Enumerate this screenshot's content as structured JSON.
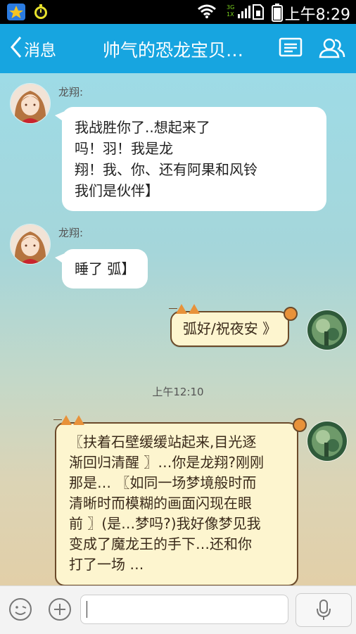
{
  "status_bar": {
    "network": "3G 1X",
    "time": "上午8:29"
  },
  "header": {
    "back_label": "消息",
    "title": "帅气的恐龙宝贝…"
  },
  "messages": [
    {
      "side": "left",
      "sender": "龙翔:",
      "lines": [
        "我战胜你了..想起来了",
        "吗！羽！我是龙",
        "翔！我、你、还有阿果和风铃",
        "我们是伙伴】"
      ]
    },
    {
      "side": "left",
      "sender": "龙翔:",
      "lines": [
        "睡了 弧】"
      ]
    },
    {
      "side": "right",
      "lines": [
        "弧好/祝夜安 》"
      ]
    },
    {
      "side": "right",
      "lines": [
        "〖扶着石壁缓缓站起来,目光逐",
        "渐回归清醒 〗…你是龙翔?刚刚",
        "那是… 〖如同一场梦境般时而",
        "清晰时而模糊的画面闪现在眼",
        "前 〗(是…梦吗?)我好像梦见我",
        "变成了魔龙王的手下…还和你",
        "打了一场 …"
      ]
    }
  ],
  "timestamp": "上午12:10",
  "input": {
    "placeholder": ""
  },
  "colors": {
    "titlebar": "#17a5e0",
    "cat_bubble_fill": "#fdf5cf",
    "cat_bubble_border": "#6b4a2a",
    "cat_ear": "#e8923a"
  },
  "icons": [
    "app-star-icon",
    "stopwatch-icon",
    "wifi-icon",
    "signal-icon",
    "sim-icon",
    "battery-icon",
    "back-chevron-icon",
    "profile-card-icon",
    "group-members-icon",
    "emoji-icon",
    "plus-icon",
    "microphone-icon"
  ]
}
